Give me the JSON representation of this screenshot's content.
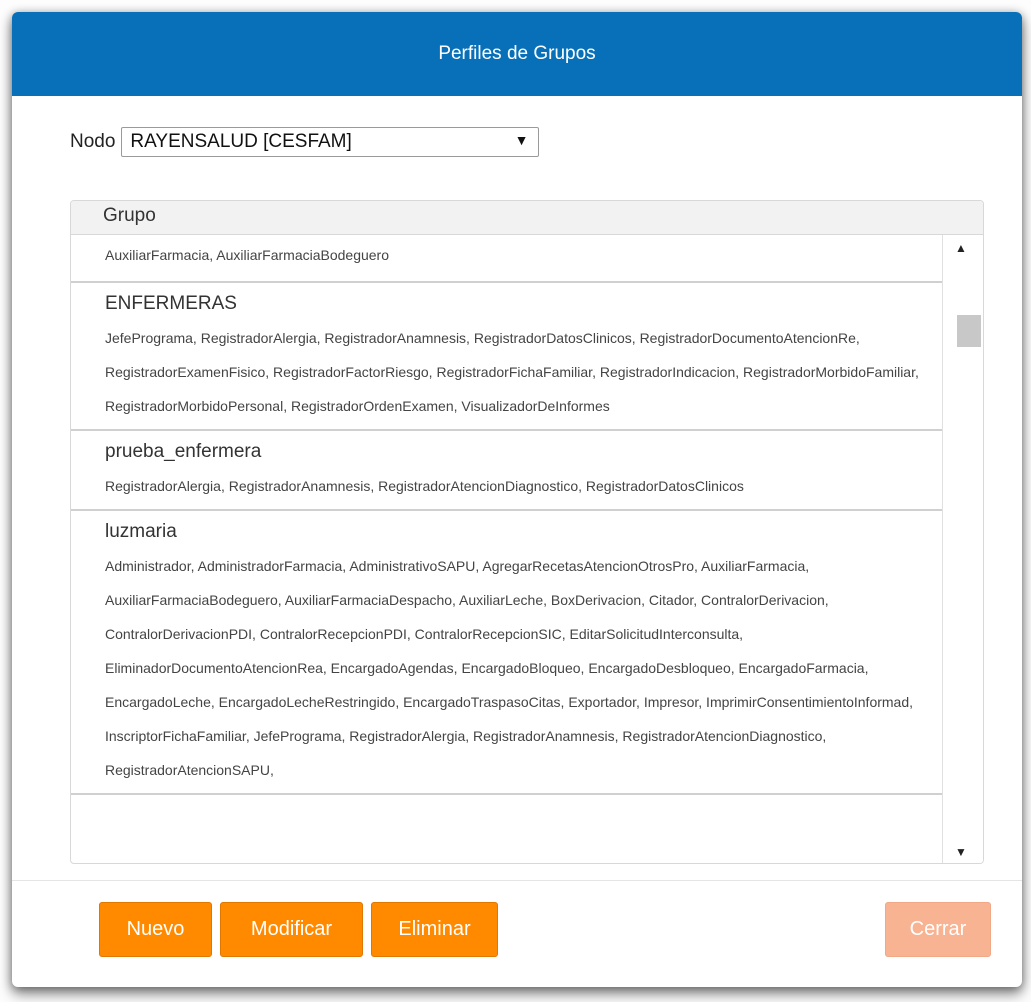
{
  "dialog": {
    "title": "Perfiles de Grupos",
    "nodo_label": "Nodo",
    "nodo_value": "RAYENSALUD [CESFAM]"
  },
  "grid": {
    "column_header": "Grupo",
    "rows": [
      {
        "name": "",
        "perms": "AuxiliarFarmacia, AuxiliarFarmaciaBodeguero"
      },
      {
        "name": "ENFERMERAS",
        "perms": "JefePrograma, RegistradorAlergia, RegistradorAnamnesis, RegistradorDatosClinicos, RegistradorDocumentoAtencionRe, RegistradorExamenFisico, RegistradorFactorRiesgo, RegistradorFichaFamiliar, RegistradorIndicacion, RegistradorMorbidoFamiliar, RegistradorMorbidoPersonal, RegistradorOrdenExamen, VisualizadorDeInformes"
      },
      {
        "name": "prueba_enfermera",
        "perms": "RegistradorAlergia, RegistradorAnamnesis, RegistradorAtencionDiagnostico, RegistradorDatosClinicos"
      },
      {
        "name": "luzmaria",
        "perms": "Administrador, AdministradorFarmacia, AdministrativoSAPU, AgregarRecetasAtencionOtrosPro, AuxiliarFarmacia, AuxiliarFarmaciaBodeguero, AuxiliarFarmaciaDespacho, AuxiliarLeche, BoxDerivacion, Citador, ContralorDerivacion, ContralorDerivacionPDI, ContralorRecepcionPDI, ContralorRecepcionSIC, EditarSolicitudInterconsulta, EliminadorDocumentoAtencionRea, EncargadoAgendas, EncargadoBloqueo, EncargadoDesbloqueo, EncargadoFarmacia, EncargadoLeche, EncargadoLecheRestringido, EncargadoTraspasoCitas, Exportador, Impresor, ImprimirConsentimientoInformad, InscriptorFichaFamiliar, JefePrograma, RegistradorAlergia, RegistradorAnamnesis, RegistradorAtencionDiagnostico, RegistradorAtencionSAPU,"
      }
    ]
  },
  "buttons": {
    "nuevo": "Nuevo",
    "modificar": "Modificar",
    "eliminar": "Eliminar",
    "cerrar": "Cerrar"
  },
  "colors": {
    "titlebar": "#0870b8",
    "button": "#ff8a00",
    "button_disabled": "#f7b392"
  },
  "icons": {
    "select_arrow": "chevron-down-icon",
    "scroll_up": "scroll-up-arrow-icon",
    "scroll_down": "scroll-down-arrow-icon"
  }
}
